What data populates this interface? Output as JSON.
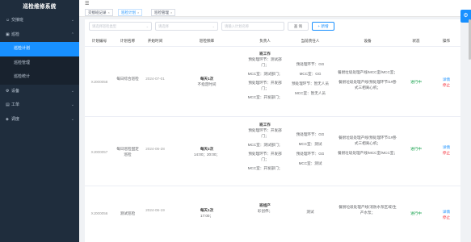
{
  "brand": "巡检维修系统",
  "sidebar": {
    "items": [
      {
        "label": "交接班",
        "icon": "user-icon",
        "caret": "⌄"
      },
      {
        "label": "巡检",
        "icon": "check-icon",
        "caret": "⌃"
      },
      {
        "label": "巡检计划",
        "sub": true,
        "active": true
      },
      {
        "label": "巡检管理",
        "sub": true
      },
      {
        "label": "巡检统计",
        "sub": true
      },
      {
        "label": "设备",
        "icon": "device-icon",
        "caret": "⌄"
      },
      {
        "label": "工单",
        "icon": "order-icon",
        "caret": "⌄"
      },
      {
        "label": "调度",
        "icon": "dispatch-icon",
        "caret": "⌄"
      }
    ]
  },
  "tags": [
    {
      "label": "交接班记录",
      "active": false
    },
    {
      "label": "巡检计划",
      "active": true
    },
    {
      "label": "巡检管理",
      "active": false
    }
  ],
  "filters": {
    "plan_type_placeholder": "请选择巡检类型",
    "status_placeholder": "请选择",
    "name_placeholder": "请输入计划名称",
    "query_label": "查 询",
    "add_label": "+ 新增"
  },
  "table": {
    "headers": [
      "计划编号",
      "计划名称",
      "开始时间",
      "巡检频率",
      "负责人",
      "当前责任人",
      "设备",
      "状态",
      "操作"
    ],
    "rows": [
      {
        "code": "XJ000058",
        "name": "每日综合巡检",
        "start": "2024-07-01",
        "freq_title": "每天1次",
        "freq_detail": "不指定时间",
        "owner": [
          "班工作",
          "预处理环节：测试部门；",
          "MCC室：测试部门；",
          "预处理环节：开发部门；",
          "MCC室：开发部门；"
        ],
        "current": [
          "预处理环节：GG",
          "MCC室：GG",
          "预处理环节：暂无人员",
          "MCC室：暂无人员"
        ],
        "device": [
          "餐厨垃圾处理产线/MCC室/MCC室；",
          "餐厨垃圾处理产线/预处理环节/1#卧式三相离心机；"
        ],
        "status": "进行中",
        "edit": "详情",
        "stop": "停止"
      },
      {
        "code": "XJ000057",
        "name": "每日巡检固定巡检",
        "start": "2024-06-28",
        "freq_title": "每天2次",
        "freq_detail": "14:00；20:00；",
        "owner": [
          "班工作",
          "预处理环节：开发部门；",
          "MCC室：测试部门；",
          "预处理环节：开发部门；",
          "MCC室：开发部门；"
        ],
        "current": [
          "预处理环节：GG",
          "MCC室：测试",
          "预处理环节：GG",
          "MCC室：测试"
        ],
        "device": [
          "餐厨垃圾处理产线/预处理环节/1#卧式三相离心机；",
          "餐厨垃圾处理产线/MCC室/MCC室；"
        ],
        "status": "进行中",
        "edit": "详情",
        "stop": "停止"
      },
      {
        "code": "XJ000056",
        "name": "测试巡检",
        "start": "2024-06-19",
        "freq_title": "每天1次",
        "freq_detail": "17:00；",
        "owner": [
          "班组产",
          "彩创伟；"
        ],
        "current": [
          "测试"
        ],
        "device": [
          "餐厨垃圾处理产线/消防水泵区域/生产水泵；"
        ],
        "status": "进行中",
        "edit": "详情",
        "stop": "停止"
      }
    ]
  }
}
